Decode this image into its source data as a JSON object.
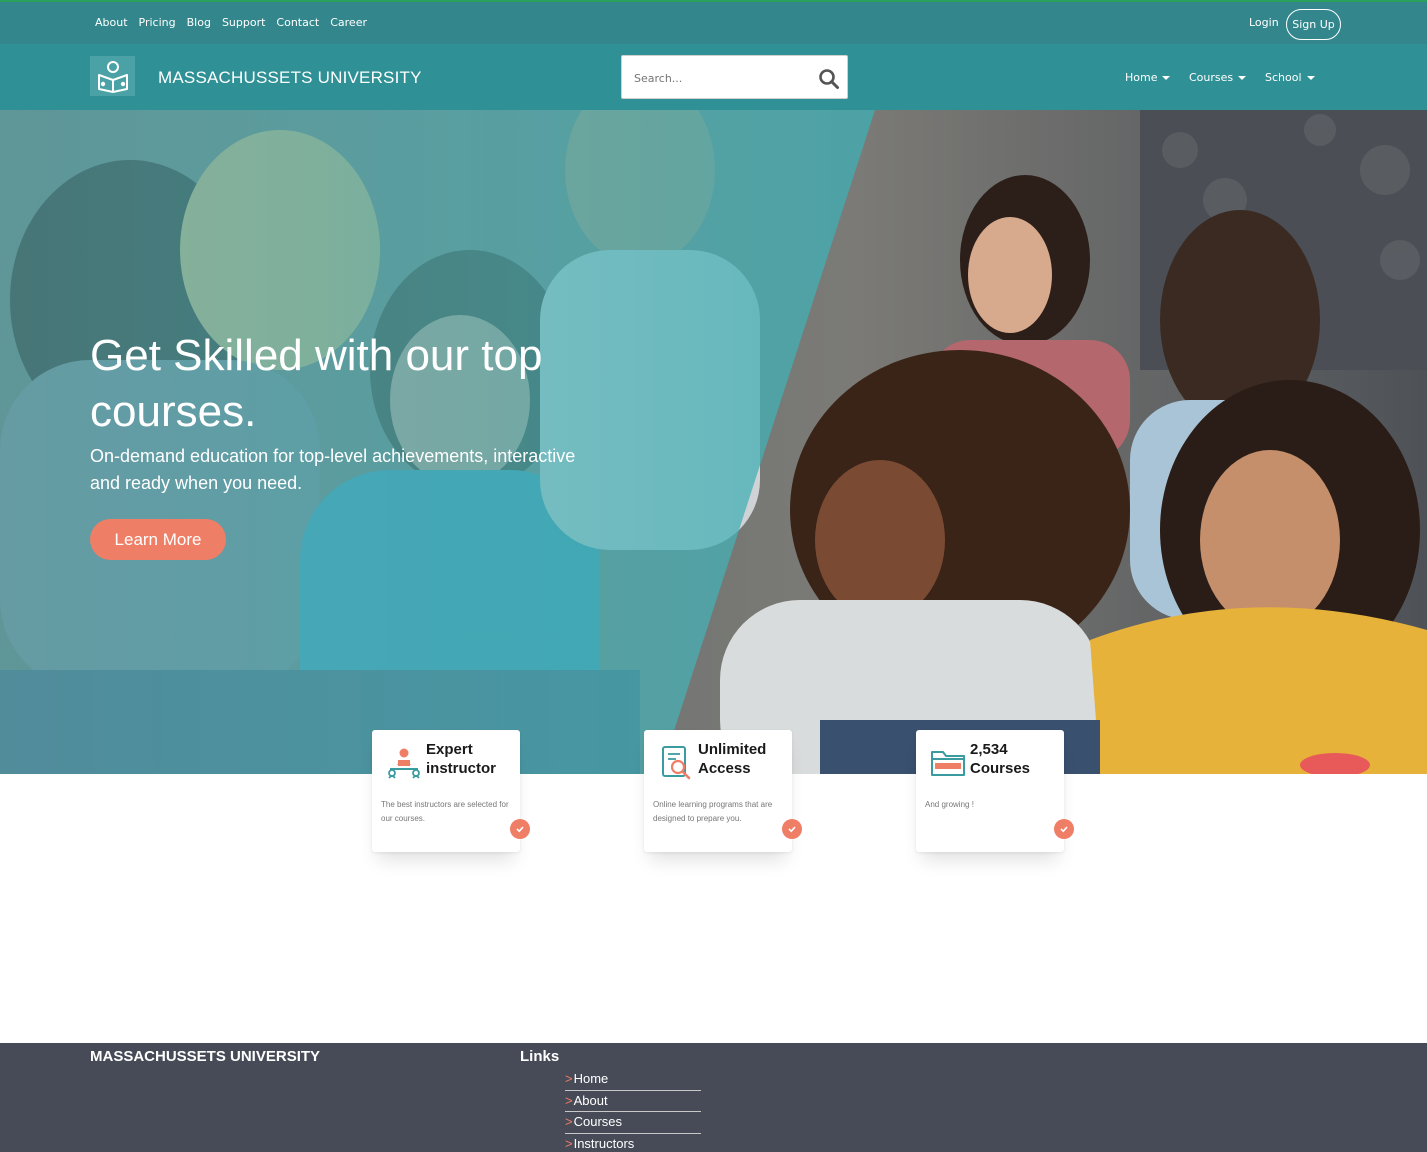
{
  "topbar": {
    "links": [
      "About",
      "Pricing",
      "Blog",
      "Support",
      "Contact",
      "Career"
    ],
    "login": "Login",
    "signup": "Sign Up"
  },
  "nav": {
    "brand": "MASSACHUSSETS UNIVERSITY",
    "search_placeholder": "Search...",
    "menu": [
      "Home",
      "Courses",
      "School"
    ]
  },
  "hero": {
    "title": "Get Skilled with our top courses.",
    "subtitle": "On-demand education for top-level achievements, interactive and ready when you need.",
    "cta": "Learn More"
  },
  "features": [
    {
      "icon": "instructor-icon",
      "title": "Expert instructor",
      "desc": "The best instructors are selected for our courses."
    },
    {
      "icon": "certificate-icon",
      "title": "Unlimited Access",
      "desc": "Online learning programs that are designed to prepare you."
    },
    {
      "icon": "folder-icon",
      "title": "2,534 Courses",
      "desc": "And growing !"
    }
  ],
  "footer": {
    "brand": "MASSACHUSSETS UNIVERSITY",
    "links_title": "Links",
    "links": [
      "Home",
      "About",
      "Courses",
      "Instructors"
    ]
  },
  "colors": {
    "topbar": "#33878c",
    "nav": "#2f9196",
    "accent": "#ef7e66",
    "footer": "#464b57"
  }
}
